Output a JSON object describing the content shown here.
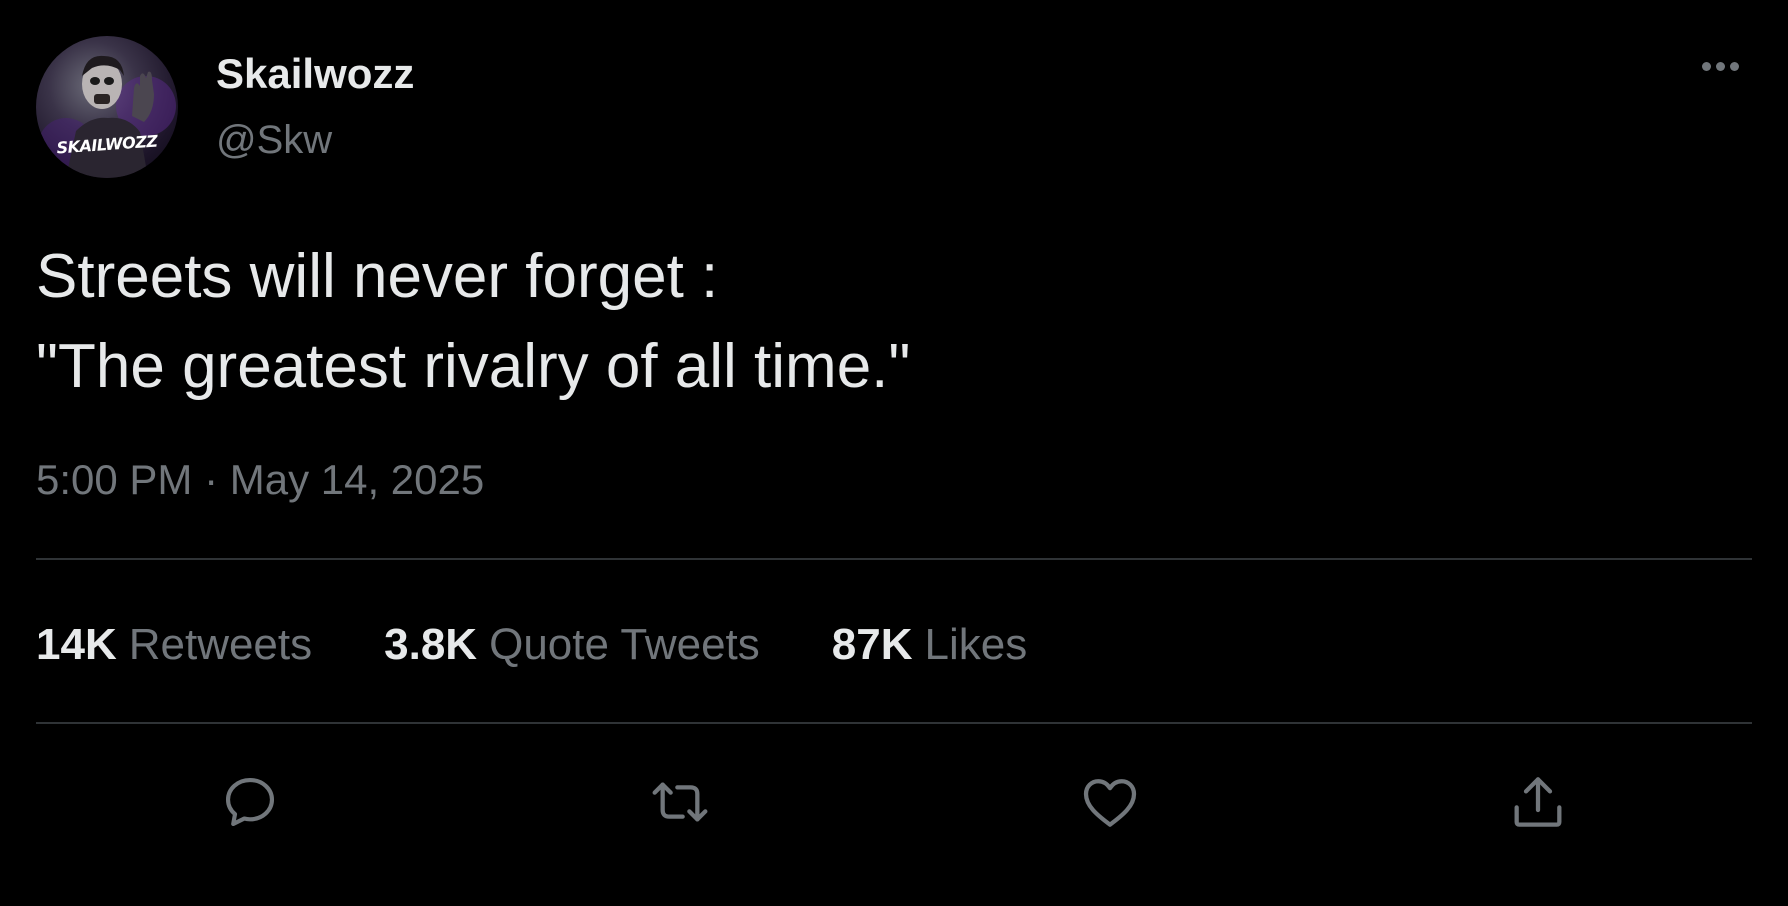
{
  "author": {
    "display_name": "Skailwozz",
    "handle": "@Skw",
    "avatar_text": "SKAILWOZZ"
  },
  "tweet": {
    "lines": [
      "Streets will never forget :",
      "\"The greatest rivalry of all time.\""
    ],
    "timestamp": "5:00 PM · May 14, 2025"
  },
  "stats": {
    "retweets": {
      "count": "14K",
      "label": "Retweets"
    },
    "quote_tweets": {
      "count": "3.8K",
      "label": "Quote Tweets"
    },
    "likes": {
      "count": "87K",
      "label": "Likes"
    }
  },
  "actions": [
    {
      "name": "reply-icon"
    },
    {
      "name": "retweet-icon"
    },
    {
      "name": "like-icon"
    },
    {
      "name": "share-icon"
    }
  ],
  "colors": {
    "background": "#000000",
    "primary_text": "#e7e9ea",
    "secondary_text": "#71767b",
    "divider": "#2f3336"
  }
}
